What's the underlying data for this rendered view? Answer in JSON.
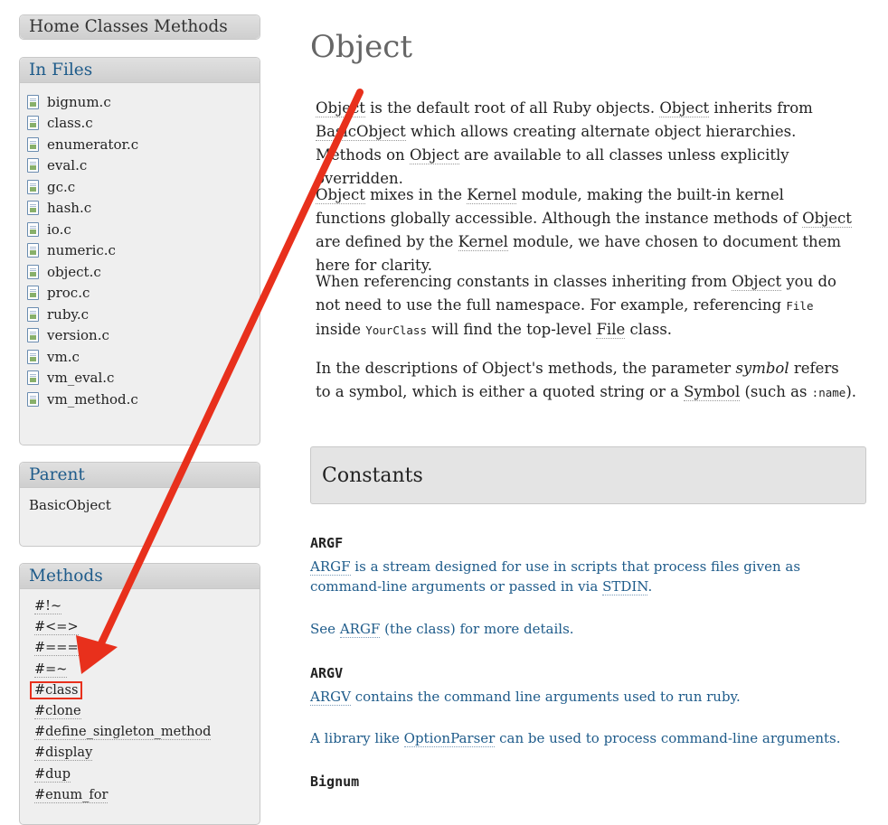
{
  "nav": {
    "label": "Home Classes Methods"
  },
  "files": {
    "title": "In Files",
    "items": [
      "bignum.c",
      "class.c",
      "enumerator.c",
      "eval.c",
      "gc.c",
      "hash.c",
      "io.c",
      "numeric.c",
      "object.c",
      "proc.c",
      "ruby.c",
      "version.c",
      "vm.c",
      "vm_eval.c",
      "vm_method.c"
    ]
  },
  "parent": {
    "title": "Parent",
    "name": "BasicObject"
  },
  "methods": {
    "title": "Methods",
    "items": [
      "#!~",
      "#<=>",
      "#===",
      "#=~",
      "#class",
      "#clone",
      "#define_singleton_method",
      "#display",
      "#dup",
      "#enum_for"
    ],
    "highlighted": "#class"
  },
  "main": {
    "title": "Object",
    "p1": {
      "a": "Object",
      "b": " is the default root of all Ruby objects. ",
      "c": "Object",
      "d": " inherits from ",
      "e": "BasicObject",
      "f": " which allows creating alternate object hierarchies. Methods on ",
      "g": "Object",
      "h": " are available to all classes unless explicitly overridden."
    },
    "p2": {
      "a": "Object",
      "b": " mixes in the ",
      "c": "Kernel",
      "d": " module, making the built-in kernel functions globally accessible. Although the instance methods of ",
      "e": "Object",
      "f": " are defined by the ",
      "g": "Kernel",
      "h": " module, we have chosen to document them here for clarity."
    },
    "p3": {
      "a": "When referencing constants in classes inheriting from ",
      "b": "Object",
      "c": " you do not need to use the full namespace. For example, referencing ",
      "d": "File",
      "e": " inside ",
      "f": "YourClass",
      "g": " will find the top-level ",
      "h": "File",
      "i": " class."
    },
    "p4": {
      "a": "In the descriptions of Object's methods, the parameter ",
      "b": "symbol",
      "c": " refers to a symbol, which is either a quoted string or a ",
      "d": "Symbol",
      "e": " (such as ",
      "f": ":name",
      "g": ")."
    },
    "constants_heading": "Constants",
    "constants": [
      {
        "name": "ARGF",
        "desc1_a": "ARGF",
        "desc1_b": " is a stream designed for use in scripts that process files given as command-line arguments or passed in via ",
        "desc1_c": "STDIN",
        "desc1_d": ".",
        "desc2_a": "See ",
        "desc2_b": "ARGF",
        "desc2_c": " (the class) for more details."
      },
      {
        "name": "ARGV",
        "desc1_a": "ARGV",
        "desc1_b": " contains the command line arguments used to run ruby.",
        "desc2_a": "A library like ",
        "desc2_b": "OptionParser",
        "desc2_c": " can be used to process command-line arguments."
      },
      {
        "name": "Bignum"
      }
    ]
  },
  "colors": {
    "link_blue": "#1e5b8a",
    "annotation_red": "#e8301c"
  }
}
